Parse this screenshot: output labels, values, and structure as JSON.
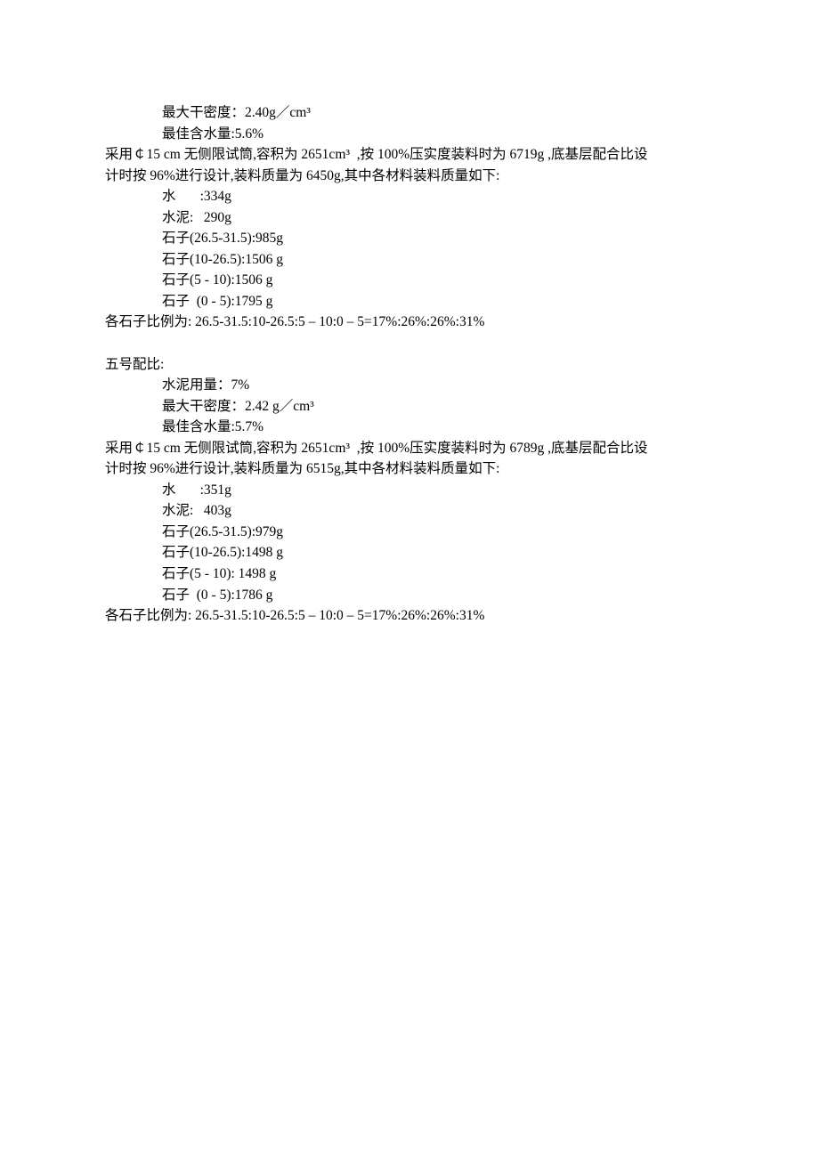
{
  "mix4": {
    "density": "最大干密度：2.40g／cm³",
    "water_content": "最佳含水量:5.6%",
    "desc_l1": "采用￠15 cm 无侧限试筒,容积为 2651cm³  ,按 100%压实度装料时为 6719g ,底基层配合比设",
    "desc_l2": "计时按 96%进行设计,装料质量为 6450g,其中各材料装料质量如下:",
    "water": "水       :334g",
    "cement": "水泥:   290g",
    "stone1": "石子(26.5-31.5):985g",
    "stone2": "石子(10-26.5):1506 g",
    "stone3": "石子(5 - 10):1506 g",
    "stone4": "石子  (0 - 5):1795 g",
    "ratio": "各石子比例为: 26.5-31.5:10-26.5:5 – 10:0 – 5=17%:26%:26%:31%"
  },
  "mix5": {
    "title": "五号配比:",
    "cement_use": "水泥用量：7%",
    "density": "最大干密度：2.42 g／cm³",
    "water_content": "最佳含水量:5.7%",
    "desc_l1": "采用￠15 cm 无侧限试筒,容积为 2651cm³  ,按 100%压实度装料时为 6789g ,底基层配合比设",
    "desc_l2": "计时按 96%进行设计,装料质量为 6515g,其中各材料装料质量如下:",
    "water": "水       :351g",
    "cement": "水泥:   403g",
    "stone1": "石子(26.5-31.5):979g",
    "stone2": "石子(10-26.5):1498 g",
    "stone3": "石子(5 - 10): 1498 g",
    "stone4": "石子  (0 - 5):1786 g",
    "ratio": "各石子比例为: 26.5-31.5:10-26.5:5 – 10:0 – 5=17%:26%:26%:31%"
  }
}
